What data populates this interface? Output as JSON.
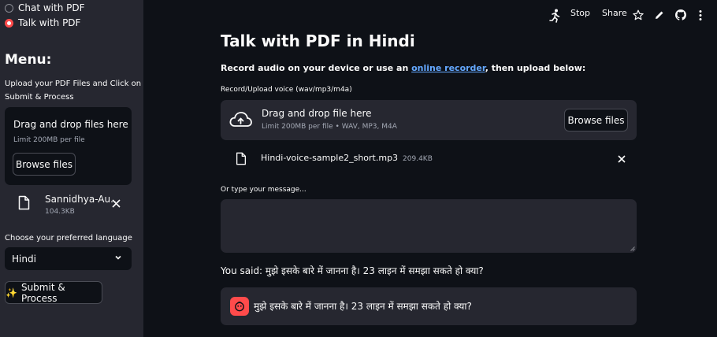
{
  "sidebar": {
    "nav": [
      {
        "label": "Chat with PDF",
        "selected": false
      },
      {
        "label": "Talk with PDF",
        "selected": true
      }
    ],
    "menu_title": "Menu:",
    "upload_label_line1": "Upload your PDF Files and Click on",
    "upload_label_line2": "Submit & Process",
    "dropzone": {
      "title": "Drag and drop files here",
      "limit": "Limit 200MB per file",
      "browse": "Browse files"
    },
    "uploaded_file": {
      "name": "Sannidhya-Au...",
      "size": "104.3KB"
    },
    "language_label": "Choose your preferred language",
    "language_value": "Hindi",
    "submit_label": "Submit & Process",
    "submit_icon": "✨"
  },
  "topbar": {
    "stop": "Stop",
    "share": "Share",
    "icons": [
      "running-icon",
      "star-icon",
      "edit-icon",
      "github-icon",
      "more-icon"
    ]
  },
  "main": {
    "title": "Talk with PDF in Hindi",
    "instruction_pre": "Record audio on your device or use an ",
    "instruction_link": "online recorder",
    "instruction_post": ", then upload below:",
    "upload_label": "Record/Upload voice (wav/mp3/m4a)",
    "dropzone": {
      "title": "Drag and drop file here",
      "limit": "Limit 200MB per file • WAV, MP3, M4A",
      "browse": "Browse files"
    },
    "audio_file": {
      "name": "Hindi-voice-sample2_short.mp3",
      "size": "209.4KB"
    },
    "type_label": "Or type your message...",
    "you_said": "You said: मुझे इसके बारे में जानना है। 23 लाइन में समझा सकते हो क्या?",
    "chat_message": "मुझे इसके बारे में जानना है। 23 लाइन में समझा सकते हो क्या?"
  },
  "colors": {
    "accent": "#ff4b4b",
    "link": "#64a8ff",
    "sidebar_bg": "#262730",
    "main_bg": "#0e1117"
  }
}
